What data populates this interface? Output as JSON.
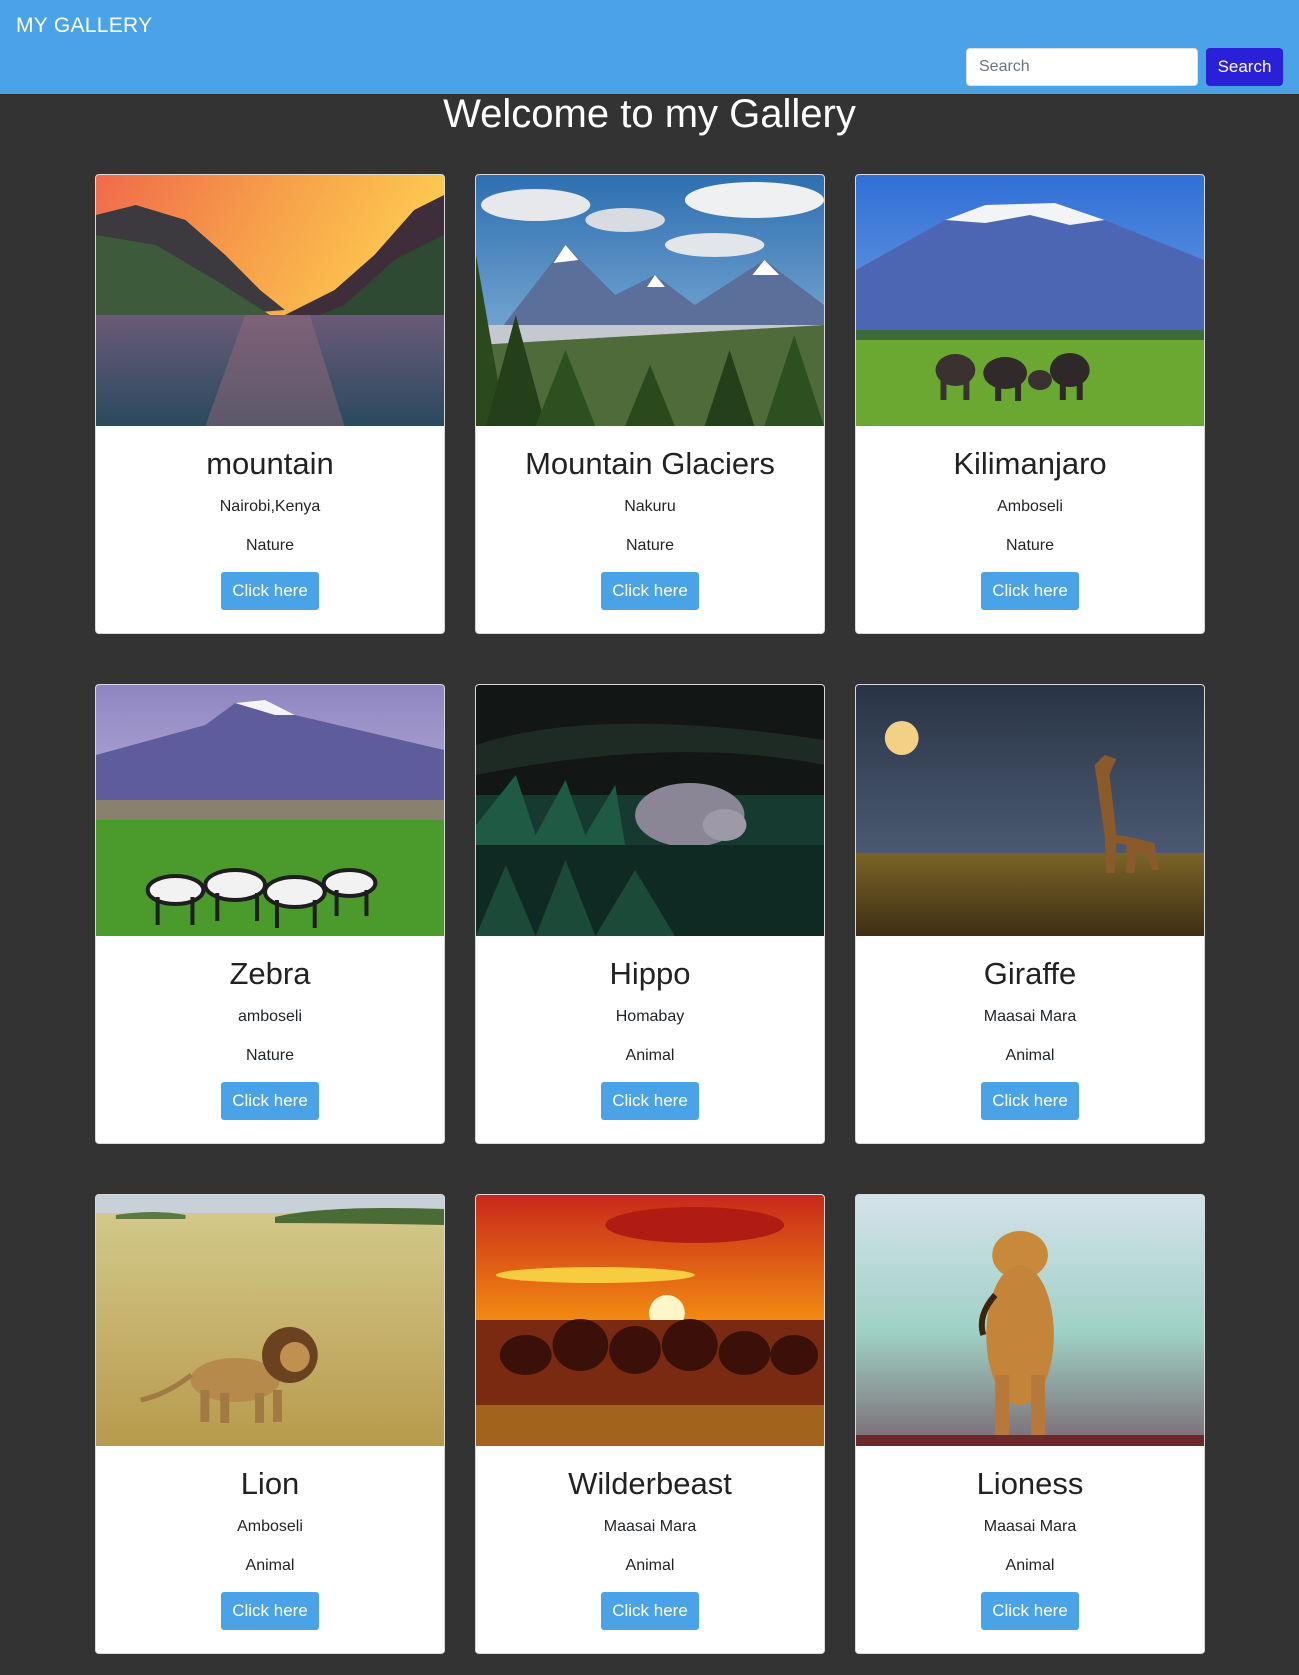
{
  "navbar": {
    "brand": "MY GALLERY",
    "search_placeholder": "Search",
    "search_button": "Search"
  },
  "page_title": "Welcome to my Gallery",
  "cards": [
    {
      "title": "mountain",
      "location": "Nairobi,Kenya",
      "category": "Nature",
      "button": "Click here",
      "image": "sunset-lake-between-mountains"
    },
    {
      "title": "Mountain Glaciers",
      "location": "Nakuru",
      "category": "Nature",
      "button": "Click here",
      "image": "snowy-mountains-with-forest"
    },
    {
      "title": "Kilimanjaro",
      "location": "Amboseli",
      "category": "Nature",
      "button": "Click here",
      "image": "kilimanjaro-with-elephants"
    },
    {
      "title": "Zebra",
      "location": "amboseli",
      "category": "Nature",
      "button": "Click here",
      "image": "zebras-grazing-below-mountain"
    },
    {
      "title": "Hippo",
      "location": "Homabay",
      "category": "Animal",
      "button": "Click here",
      "image": "hippo-in-dark-water"
    },
    {
      "title": "Giraffe",
      "location": "Maasai Mara",
      "category": "Animal",
      "button": "Click here",
      "image": "giraffe-under-moon"
    },
    {
      "title": "Lion",
      "location": "Amboseli",
      "category": "Animal",
      "button": "Click here",
      "image": "lion-in-tall-grass"
    },
    {
      "title": "Wilderbeast",
      "location": "Maasai Mara",
      "category": "Animal",
      "button": "Click here",
      "image": "wildebeest-at-sunset"
    },
    {
      "title": "Lioness",
      "location": "Maasai Mara",
      "category": "Animal",
      "button": "Click here",
      "image": "lioness-walking-in-mist"
    }
  ]
}
